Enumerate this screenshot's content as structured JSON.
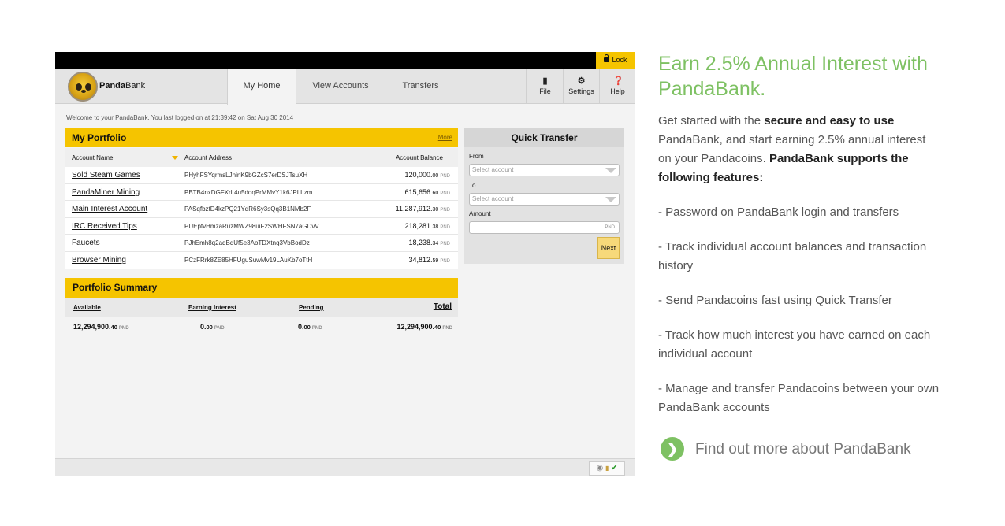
{
  "app": {
    "lock_label": "Lock",
    "brand": {
      "prefix": "Panda",
      "suffix": "Bank"
    },
    "tabs": [
      {
        "label": "My Home",
        "active": true
      },
      {
        "label": "View Accounts",
        "active": false
      },
      {
        "label": "Transfers",
        "active": false
      }
    ],
    "toolbar": {
      "file": "File",
      "settings": "Settings",
      "help": "Help"
    },
    "welcome": "Welcome to your PandaBank, You last logged on at 21:39:42 on Sat Aug 30 2014",
    "portfolio": {
      "title": "My Portfolio",
      "more": "More",
      "columns": [
        "Account Name",
        "Account Address",
        "Account Balance"
      ],
      "rows": [
        {
          "name": "Sold Steam Games",
          "address": "PHyhFSYqrmsLJninK9bGZcS7erDSJTsuXH",
          "balance_main": "120,000.",
          "balance_dec": "00",
          "unit": "PND"
        },
        {
          "name": "PandaMiner Mining",
          "address": "PBTB4nxDGFXrL4u5ddqPrMMvY1k6JPLLzm",
          "balance_main": "615,656.",
          "balance_dec": "60",
          "unit": "PND"
        },
        {
          "name": "Main Interest Account",
          "address": "PASqfbztD4kzPQ21YdR6Sy3sQq3B1NMb2F",
          "balance_main": "11,287,912.",
          "balance_dec": "30",
          "unit": "PND"
        },
        {
          "name": "IRC Received Tips",
          "address": "PUEpfvHmzaRuzMWZ98uiF2SWHFSN7aGDvV",
          "balance_main": "218,281.",
          "balance_dec": "38",
          "unit": "PND"
        },
        {
          "name": "Faucets",
          "address": "PJhEmh8q2aqBdUf5e3AoTDXtnq3VbBodDz",
          "balance_main": "18,238.",
          "balance_dec": "34",
          "unit": "PND"
        },
        {
          "name": "Browser Mining",
          "address": "PCzFRrk8ZE85HFUguSuwMv19LAuKb7oTtH",
          "balance_main": "34,812.",
          "balance_dec": "59",
          "unit": "PND"
        }
      ]
    },
    "summary": {
      "title": "Portfolio Summary",
      "headers": {
        "available": "Available",
        "earning": "Earning Interest",
        "pending": "Pending",
        "total": "Total"
      },
      "values": {
        "available_main": "12,294,900.",
        "available_dec": "40",
        "earning_main": "0.",
        "earning_dec": "00",
        "pending_main": "0.",
        "pending_dec": "00",
        "total_main": "12,294,900.",
        "total_dec": "40",
        "unit": "PND"
      }
    },
    "quick_transfer": {
      "title": "Quick Transfer",
      "from_label": "From",
      "from_placeholder": "Select account",
      "to_label": "To",
      "to_placeholder": "Select account",
      "amount_label": "Amount",
      "amount_unit": "PND",
      "next": "Next"
    }
  },
  "marketing": {
    "headline": "Earn 2.5% Annual Interest with PandaBank.",
    "intro": {
      "part1": "Get started with the ",
      "bold1": "secure and easy to use",
      "part2": " PandaBank, and start earning 2.5% annual interest on your Pandacoins. ",
      "bold2": "PandaBank supports the following features:"
    },
    "features": [
      "- Password on PandaBank login and transfers",
      "- Track individual account balances and transaction history",
      "- Send Pandacoins fast using Quick Transfer",
      "- Track how much interest you have earned on each individual account",
      "- Manage and transfer Pandacoins between your own PandaBank accounts"
    ],
    "cta": "Find out more about PandaBank",
    "accent_color": "#7ec163"
  }
}
